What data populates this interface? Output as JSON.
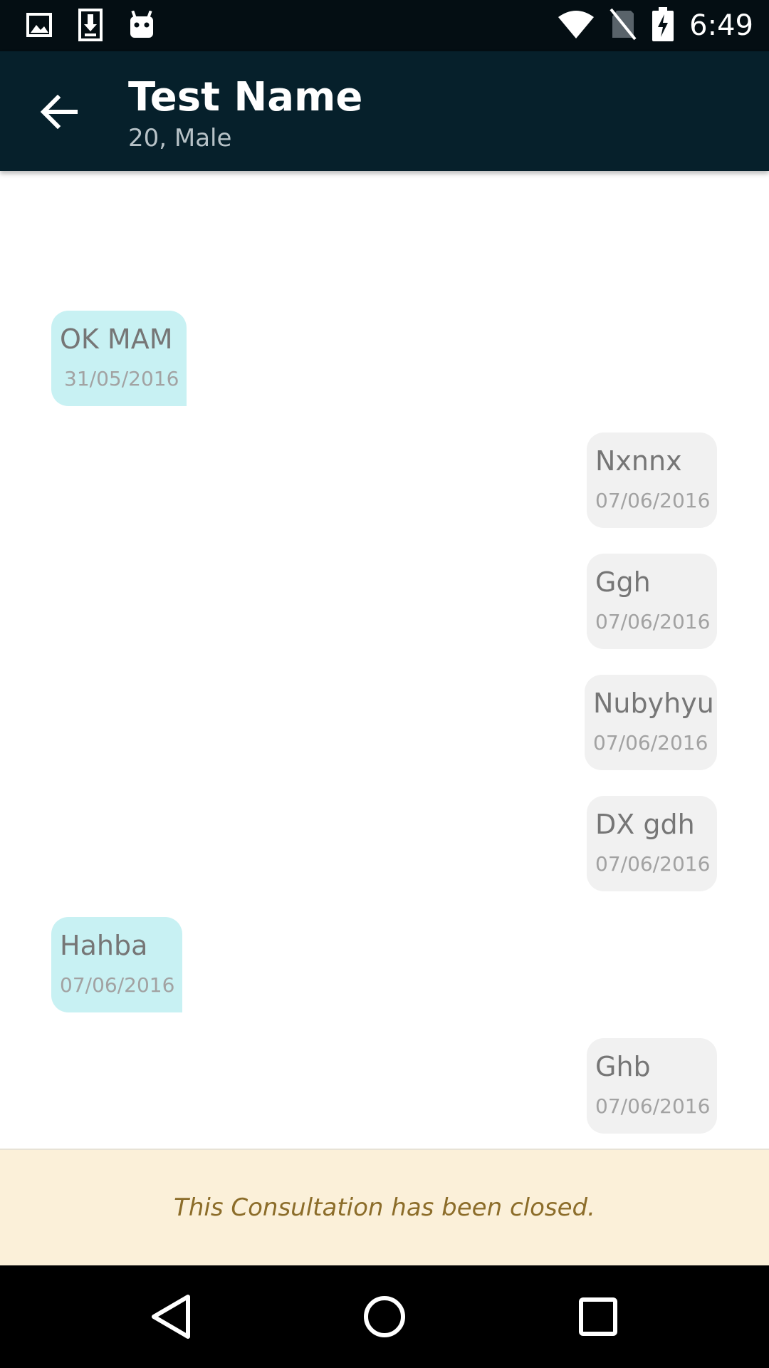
{
  "status_bar": {
    "time": "6:49",
    "left_icons": [
      "image-icon",
      "download-icon",
      "android-icon"
    ],
    "right_icons": [
      "wifi-icon",
      "no-sim-icon",
      "battery-charging-icon"
    ]
  },
  "app_bar": {
    "back_icon": "arrow-back-icon",
    "title": "Test Name",
    "subtitle": "20, Male"
  },
  "messages": [
    {
      "direction": "in",
      "text": "OK MAM",
      "date": "31/05/2016"
    },
    {
      "direction": "out",
      "text": "Nxnnx",
      "date": "07/06/2016"
    },
    {
      "direction": "out",
      "text": "Ggh",
      "date": "07/06/2016"
    },
    {
      "direction": "out",
      "text": "Nubyhyu",
      "date": "07/06/2016"
    },
    {
      "direction": "out",
      "text": "DX gdh",
      "date": "07/06/2016"
    },
    {
      "direction": "in",
      "text": "Hahba",
      "date": "07/06/2016"
    },
    {
      "direction": "out",
      "text": "Ghb",
      "date": "07/06/2016"
    }
  ],
  "banner": {
    "text": "This Consultation has been closed."
  },
  "nav_bar": {
    "buttons": [
      "back-triangle-icon",
      "home-circle-icon",
      "recents-square-icon"
    ]
  },
  "colors": {
    "status_bar": "#040e13",
    "app_bar": "#06202b",
    "incoming_bubble": "#c8f1f3",
    "outgoing_bubble": "#f1f1f1",
    "banner_bg": "#fbf0d9",
    "banner_text": "#8c6d2a"
  }
}
